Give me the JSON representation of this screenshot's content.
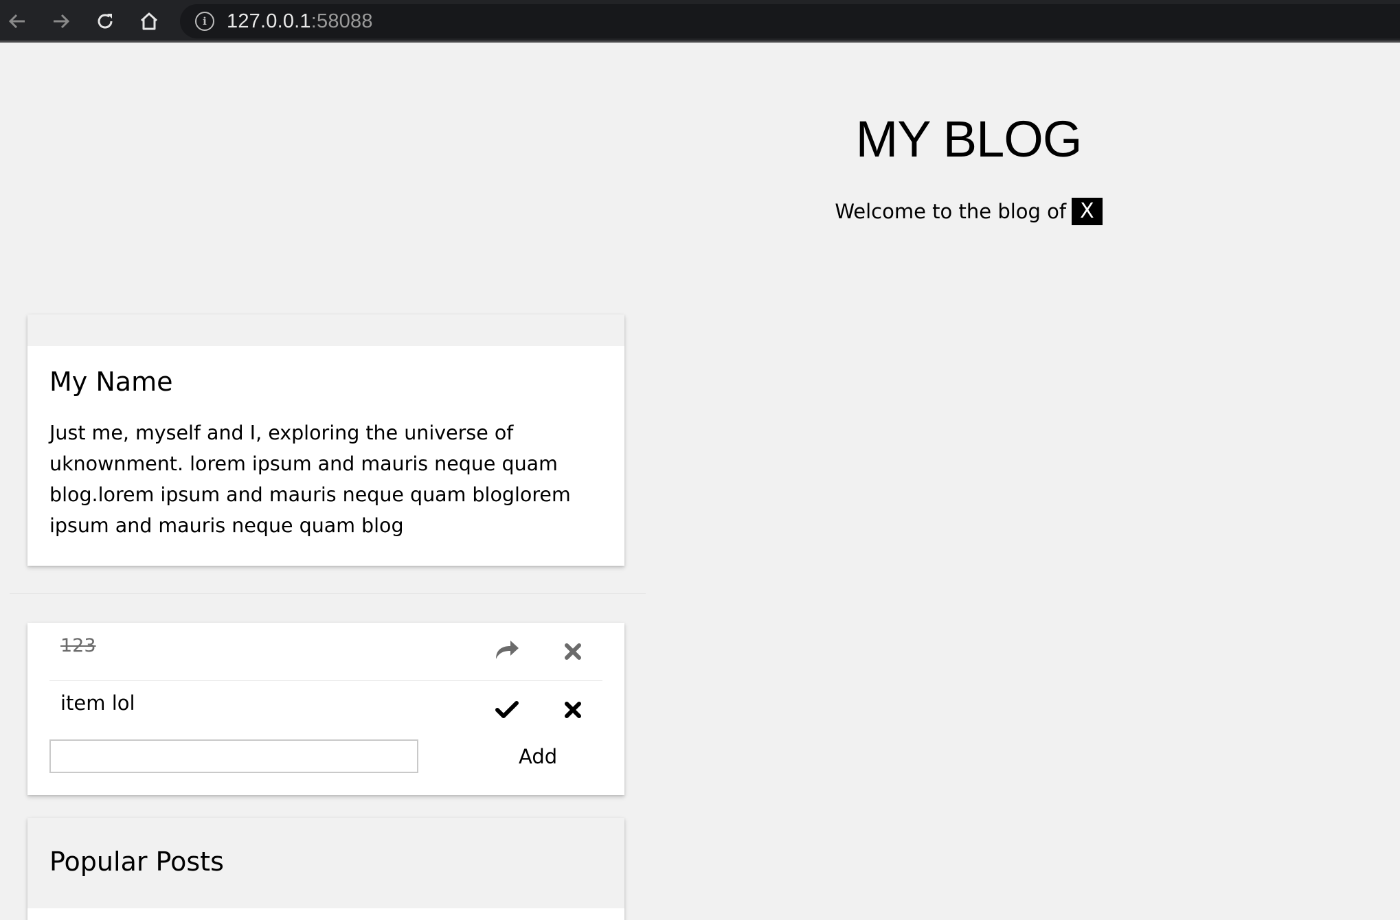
{
  "browser": {
    "url_host": "127.0.0.1",
    "url_port": ":58088",
    "icons": [
      "back-arrow-icon",
      "forward-arrow-icon",
      "reload-icon",
      "home-icon",
      "info-icon"
    ]
  },
  "header": {
    "title": "MY BLOG",
    "welcome_text": "Welcome to the blog of",
    "welcome_tag": "X"
  },
  "about": {
    "name": "My Name",
    "text": "Just me, myself and I, exploring the universe of uknownment. lorem ipsum and mauris neque quam blog.lorem ipsum and mauris neque quam bloglorem ipsum and mauris neque quam blog"
  },
  "todo": {
    "items": [
      {
        "text": "123",
        "done": true,
        "action_icon": "redo-arrow-icon",
        "remove_icon": "close-icon"
      },
      {
        "text": "item lol",
        "done": false,
        "action_icon": "checkmark-icon",
        "remove_icon": "close-icon"
      }
    ],
    "input_value": "",
    "add_label": "Add"
  },
  "popular": {
    "title": "Popular Posts"
  },
  "colors": {
    "page_bg": "#f1f1f1",
    "chrome_bg": "#222326",
    "done_icon": "#6b6b6b",
    "active_icon": "#000000"
  }
}
